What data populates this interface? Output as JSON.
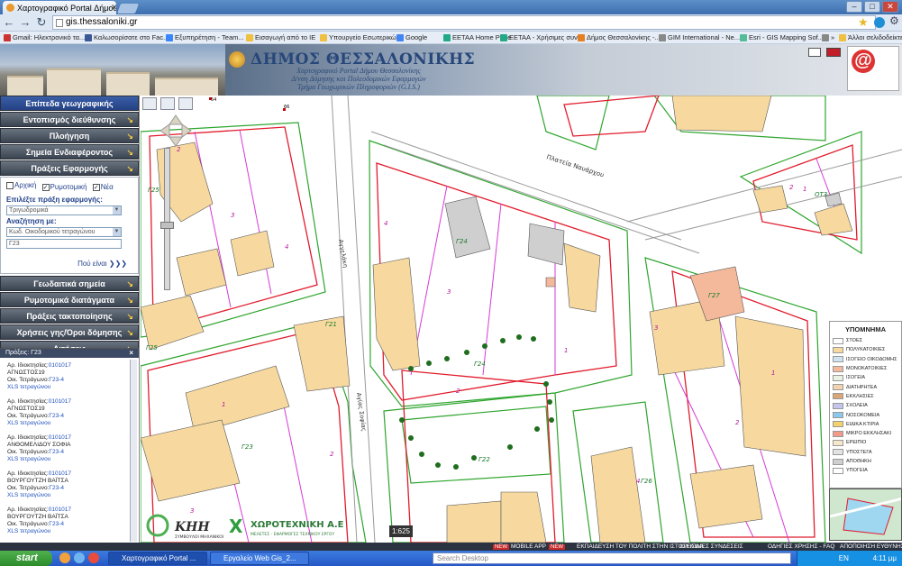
{
  "browser": {
    "tab_title": "Χαρτογραφικό Portal Δήμου",
    "url": "gis.thessaloniki.gr",
    "bookmarks": [
      "Gmail: Ηλεκτρονικό τα...",
      "Καλωσορίσατε στο Fac...",
      "Εξυπηρέτηση - Team...",
      "Εισαγωγή από το IE",
      "Υπουργείο Εσωτερικώ...",
      "Google",
      "EETAA Home Page",
      "EETAA - Χρήσιμες συν...",
      "Δήμος Θεσσαλονίκης -...",
      "GIM International - Ne...",
      "Esri - GIS Mapping Sof...",
      "»",
      "Άλλοι σελιδοδείκτες"
    ]
  },
  "header": {
    "title": "ΔΗΜΟΣ ΘΕΣΣΑΛΟΝΙΚΗΣ",
    "sub1": "Χαρτογραφικό Portal Δήμου Θεσσαλονίκης",
    "sub2": "Δ/νση Δόμησης και Πολεοδομικών Εφαρμογών",
    "sub3": "Τμήμα Γεωχωρικών Πληροφοριών (G.I.S.)"
  },
  "sidebar": {
    "sections_top": [
      "Επίπεδα γεωγραφικής πληροφορίας",
      "Εντοπισμός διεύθυνσης",
      "Πλοήγηση",
      "Σημεία Ενδιαφέροντος",
      "Πράξεις Εφαρμογής"
    ],
    "form": {
      "chk1": "Αρχική",
      "chk2": "Ρυμοτομική",
      "chk3": "Νέα",
      "label1": "Επιλέξτε πράξη εφαρμογής:",
      "select1": "Τριγωδρομικά",
      "label2": "Αναζήτηση με:",
      "select2": "Κωδ. Οικοδομικού τετραγώνου",
      "input": "Γ23",
      "where": "Πού είναι"
    },
    "sections_bottom": [
      "Γεωδαιτικά σημεία",
      "Ρυμοτομικά διατάγματα",
      "Πράξεις τακτοποίησης",
      "Χρήσεις γης/Όροι δόμησης",
      "Αιτήσεις"
    ]
  },
  "results": {
    "header": "Πράξεις: Γ23",
    "close": "×",
    "label_owner": "Αρ. Ιδιοκτησίας:",
    "label_block": "Οικ. Τετράγωνο:",
    "xls": "XLS τετραγώνου",
    "items": [
      {
        "id": "0101017",
        "name": "ΑΓΝΩΣΤΟΣ19",
        "block": "Γ23-4"
      },
      {
        "id": "0101017",
        "name": "ΑΓΝΩΣΤΟΣ19",
        "block": "Γ23-4"
      },
      {
        "id": "0101017",
        "name": "ΑΝΘΟΜΕΛΙΔΟΥ ΣΟΦΙΑ",
        "block": "Γ23-4"
      },
      {
        "id": "0101017",
        "name": "ΒΟΥΡΓΟΥΤΖΗ ΒΑΪΤΣΑ",
        "block": "Γ23-4"
      },
      {
        "id": "0101017",
        "name": "ΒΟΥΡΓΟΥΤΖΗ ΒΑΪΤΣΑ",
        "block": "Γ23-4"
      }
    ]
  },
  "map": {
    "street_label": "Πλατεία Ναυάρχου",
    "street_label2": "Αγγελάκη",
    "street_label3": "Αγίας Σοφίας",
    "block_labels": [
      "Γ25",
      "Γ24",
      "Γ21",
      "Γ22",
      "Γ23",
      "Γ26",
      "ΟΤ3",
      "Γ27",
      "Γ28"
    ],
    "scale": "1:625",
    "company": "ΧΩΡΟΤΕΧΝΙΚΗ Α.Ε",
    "company_sub": "ΜΕΛΕΤΕΣ - ΕΦΑΡΜΟΓΕΣ ΤΕΧΝΙΚΟΥ ΕΡΓΟΥ",
    "kihi": "ΚΗΗ",
    "kihi_sub": "ΣΥΜΒΟΥΛΟΙ ΜΗΧΑΝΙΚΟΙ"
  },
  "legend": {
    "title": "ΥΠΟΜΝΗΜΑ",
    "items": [
      {
        "label": "ΣΤΟΕΣ",
        "color": "#ffffff"
      },
      {
        "label": "ΠΟΛΥΚΑΤΟΙΚΙΕΣ",
        "color": "#f7d9a0"
      },
      {
        "label": "ΙΣΟΓΕΙΟ ΟΙΚΟΔΟΜΗΣ",
        "color": "#cfe3f2"
      },
      {
        "label": "ΜΟΝΟΚΑΤΟΙΚΙΕΣ",
        "color": "#f4b99a"
      },
      {
        "label": "ΙΣΟΓΕΙΑ",
        "color": "#e9f2e3"
      },
      {
        "label": "ΔΙΑΤΗΡΗΤΕΑ",
        "color": "#f2d3b0"
      },
      {
        "label": "ΕΚΚΛΗΣΙΕΣ",
        "color": "#d9a678"
      },
      {
        "label": "ΣΧΟΛΕΙΑ",
        "color": "#c5c4ea"
      },
      {
        "label": "ΝΟΣΟΚΟΜΕΙΑ",
        "color": "#8bc8ea"
      },
      {
        "label": "ΕΙΔΙΚΑ ΚΤΙΡΙΑ",
        "color": "#f2d36b"
      },
      {
        "label": "ΜΙΚΡΟ ΕΚΚΛΗΣΑΚΙ",
        "color": "#f19a8a"
      },
      {
        "label": "ΕΡΕΙΠΙΟ",
        "color": "#f5e8c8"
      },
      {
        "label": "ΥΠΟΣΤΕΓΑ",
        "color": "#e3e3e3"
      },
      {
        "label": "ΑΠΟΘΗΚΗ",
        "color": "#cfcfcf"
      },
      {
        "label": "ΥΠΟΓΕΙΑ",
        "color": "#ffffff"
      }
    ]
  },
  "footer": {
    "new1": "NEW",
    "mobile": "MOBILE APP",
    "new2": "NEW",
    "links": [
      "ΕΚΠΑΙΔΕΥΣΗ ΤΟΥ ΠΟΛΙΤΗ ΣΤΗΝ ΙΣΤΟΣΕΛΙΔΑ",
      "ΧΡΗΣΙΜΕΣ ΣΥΝΔΕΣΕΙΣ",
      "ΟΔΗΓΙΕΣ ΧΡΗΣΗΣ - FAQ",
      "ΑΠΟΠΟΙΗΣΗ ΕΥΘΥΝΗΣ"
    ]
  },
  "taskbar": {
    "start": "start",
    "task1": "Χαρτογραφικό Portal ...",
    "task2": "Εργαλείο Web Gis_2...",
    "search": "Search Desktop",
    "lang": "EN",
    "time": "4:11 μμ"
  }
}
